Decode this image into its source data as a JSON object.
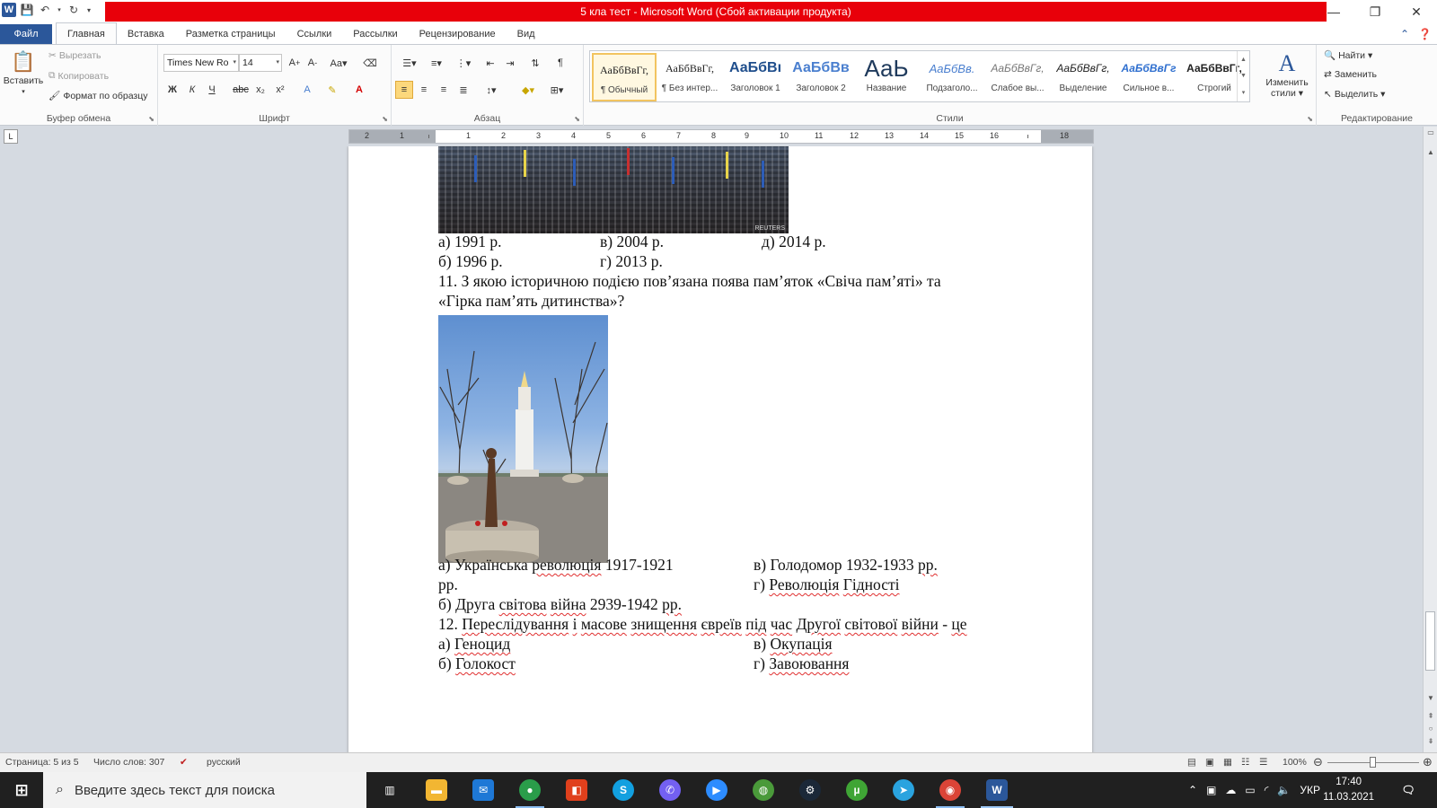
{
  "titlebar": {
    "title": "5 кла тест  -  Microsoft Word (Сбой активации продукта)",
    "app_icon": "W",
    "buttons": {
      "minimize": "—",
      "restore": "❐",
      "close": "✕"
    }
  },
  "tabs": [
    {
      "label": "Файл"
    },
    {
      "label": "Главная"
    },
    {
      "label": "Вставка"
    },
    {
      "label": "Разметка страницы"
    },
    {
      "label": "Ссылки"
    },
    {
      "label": "Рассылки"
    },
    {
      "label": "Рецензирование"
    },
    {
      "label": "Вид"
    }
  ],
  "ribbon": {
    "clipboard": {
      "label": "Буфер обмена",
      "paste": "Вставить",
      "cut": "Вырезать",
      "copy": "Копировать",
      "format_painter": "Формат по образцу"
    },
    "font": {
      "label": "Шрифт",
      "font_name": "Times New Ro",
      "font_size": "14"
    },
    "paragraph": {
      "label": "Абзац"
    },
    "styles": {
      "label": "Стили",
      "items": [
        {
          "preview": "АаБбВвГг,",
          "name": "¶ Обычный"
        },
        {
          "preview": "АаБбВвГг,",
          "name": "¶ Без интер..."
        },
        {
          "preview": "АаБбВı",
          "name": "Заголовок 1"
        },
        {
          "preview": "АаБбВв",
          "name": "Заголовок 2"
        },
        {
          "preview": "АаЬ",
          "name": "Название"
        },
        {
          "preview": "АаБбВв.",
          "name": "Подзаголо..."
        },
        {
          "preview": "АаБбВвГг,",
          "name": "Слабое вы..."
        },
        {
          "preview": "АаБбВвГг,",
          "name": "Выделение"
        },
        {
          "preview": "АаБбВвГг",
          "name": "Сильное в..."
        },
        {
          "preview": "АаБбВвГг,",
          "name": "Строгий"
        }
      ],
      "change_styles_1": "Изменить",
      "change_styles_2": "стили ▾"
    },
    "editing": {
      "label": "Редактирование",
      "find": "Найти ▾",
      "replace": "Заменить",
      "select": "Выделить ▾"
    }
  },
  "ruler": {
    "numbers": [
      "2",
      "1",
      "1",
      "2",
      "3",
      "4",
      "5",
      "6",
      "7",
      "8",
      "9",
      "10",
      "11",
      "12",
      "13",
      "14",
      "15",
      "16",
      "18"
    ]
  },
  "document": {
    "q10_options": {
      "a": "а) 1991 р.",
      "v": "в) 2004 р.",
      "d": "д) 2014 р.",
      "b": "б) 1996 р.",
      "g": "г) 2013 р."
    },
    "q11": {
      "line1": "11. З якою історичною подією пов’язана поява пам’яток «Свіча пам’яті» та",
      "line2": "«Гірка пам’ять дитинства»?",
      "a1_pre": "а) Українська ",
      "a1_word": "революція",
      "a1_post": " 1917-1921",
      "a2": "рр.",
      "v_pre": "в) Голодомор 1932-1933 ",
      "v_word": "рр.",
      "g_pre": "г) ",
      "g_w1": "Революція",
      "g_w2": "Гідності",
      "b_pre": "б) Друга ",
      "b_w1": "світова",
      "b_w2": "війна",
      "b_mid": " 2939-1942 ",
      "b_w3": "рр."
    },
    "q12": {
      "n": "12. ",
      "w1": "Переслідування",
      "w2": "і",
      "w3": "масове",
      "w4": "знищення",
      "w5": "євреїв",
      "w6": "під",
      "w7": "час",
      "w8": "Другої",
      "w9": "світової",
      "w10": "війни",
      "dash": " - ",
      "w11": "це",
      "a_pre": "а) ",
      "a": "Геноцид",
      "v_pre": "в) ",
      "v": "Окупація",
      "b_pre": "б) ",
      "b": "Голокост",
      "g_pre": "г) ",
      "g": "Завоювання"
    },
    "img1_watermark": "REUTERS"
  },
  "statusbar": {
    "page": "Страница: 5 из 5",
    "words": "Число слов: 307",
    "language": "русский",
    "zoom": "100%",
    "zoom_level": 0.5
  },
  "taskbar": {
    "search_placeholder": "Введите здесь текст для поиска",
    "language": "УКР",
    "time": "17:40",
    "date": "11.03.2021"
  }
}
